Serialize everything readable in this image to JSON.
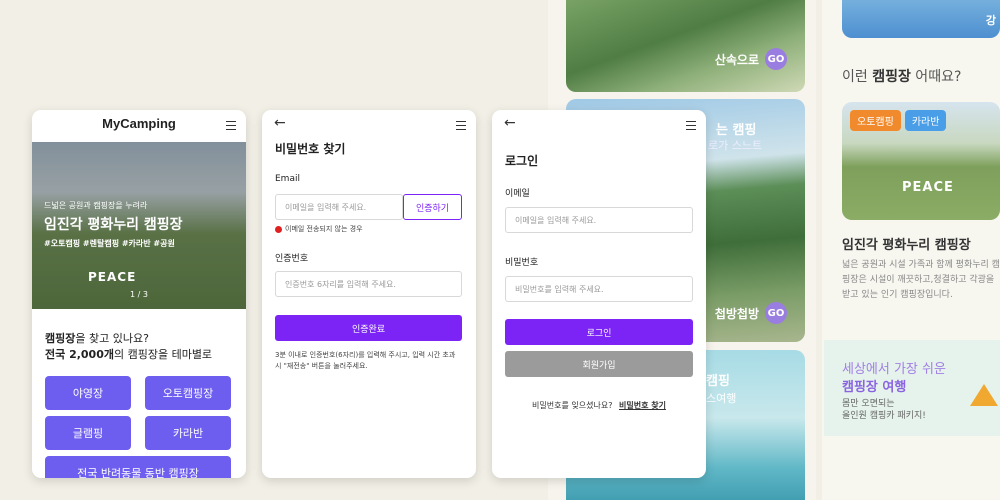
{
  "colors": {
    "accent": "#7b24f5",
    "category": "#6d5ef0",
    "go": "#9a7de0"
  },
  "bg": {
    "card1_caption": "산속으로",
    "card2_text1": "는 캠핑",
    "card2_text2": "로가 스느트",
    "card2_caption": "첩방첩방",
    "card3_text1": "캠핑",
    "card3_text2": "스여행",
    "go_label": "GO"
  },
  "right": {
    "top_text": "강",
    "question_pre": "이런 ",
    "question_strong": "캠핑장",
    "question_post": " 어때요?",
    "tags": [
      "오토캠핑",
      "카라반"
    ],
    "site_title": "임진각 평화누리 캠핑장",
    "site_desc": "넓은 공원과 시설 가족과 함께 평화누리 캠핑장은 시설이 깨끗하고,청결하고 각광을 받고 있는 인기 캠핑장입니다.",
    "promo_line1": "세상에서 가장 쉬운",
    "promo_line2": "캠핑장 여행",
    "promo_line3": "몸만 오면되는",
    "promo_line4": "올인원 캠핑카 패키지!"
  },
  "phone1": {
    "logo": "MyCamping",
    "hero_sub": "드넓은 공원과 캠핑장을 누려라",
    "hero_title": "임진각 평화누리 캠핑장",
    "hero_tags": "#오토캠핑 #렌탈캠핑 #카라반 #공원",
    "hero_sign": "PEACE",
    "pager": "1 / 3",
    "headline1_strong": "캠핑장",
    "headline1_rest": "을 찾고 있나요?",
    "headline2_strong": "전국 2,000개",
    "headline2_rest": "의 캠핑장을 테마별로",
    "categories": [
      "야영장",
      "오토캠핑장",
      "글램핑",
      "카라반"
    ],
    "category_wide": "전국 반려동물 동반 캠핑장"
  },
  "phone2": {
    "back": "←",
    "title": "비밀번호 찾기",
    "email_label": "Email",
    "email_placeholder": "이메일을 입력해 주세요.",
    "verify_button": "인증하기",
    "error_text": "이메일 전송되지 않는 경우",
    "code_label": "인증번호",
    "code_placeholder": "인증번호 6자리를 입력해 주세요.",
    "complete_button": "인증완료",
    "note": "3분 이내로 인증번호(6자리)를 입력해 주시고, 입력 시간 초과 시 \"재전송\" 버튼을 눌러주세요."
  },
  "phone3": {
    "back": "←",
    "title": "로그인",
    "email_label": "이메일",
    "email_placeholder": "이메일을 입력해 주세요.",
    "pw_label": "비밀번호",
    "pw_placeholder": "비밀번호를 입력해 주세요.",
    "login_button": "로그인",
    "signup_button": "회원가입",
    "forgot_text": "비밀번호를 잊으셨나요?",
    "forgot_link": "비밀번호 찾기"
  }
}
